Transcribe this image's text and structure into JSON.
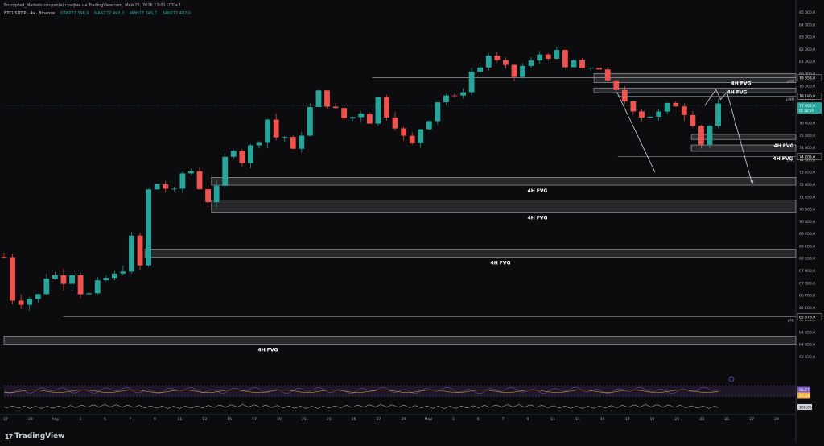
{
  "header": {
    "author_line": "Encrypted_Markets создал(а) график на TradingView.com, Май 25, 2026 12:01 UTC+3",
    "symbol": "BTCUSDT.P · 4ч · Binance",
    "open": "ОТКР77 396,9",
    "high": "МАКС77 493,0",
    "low": "МИН77 345,7",
    "close": "ЗАКР77 402,0"
  },
  "brand": {
    "mark": "17",
    "name": "TradingView"
  },
  "chart_data": {
    "type": "candlestick",
    "price_axis": {
      "ticks": [
        "85 000,0",
        "84 000,0",
        "83 000,0",
        "82 000,0",
        "81 000,0",
        "80 000,0",
        "79 000,0",
        "78 000,0",
        "77 000,0",
        "76 400,0",
        "75 600,0",
        "74 800,0",
        "74 000,0",
        "73 200,0",
        "72 400,0",
        "71 650,0",
        "70 900,0",
        "70 300,0",
        "69 700,0",
        "69 100,0",
        "68 550,0",
        "67 900,0",
        "67 300,0",
        "66 700,0",
        "66 100,0",
        "65 550,0",
        "64 950,0",
        "64 350,0",
        "63 830,0"
      ],
      "ylim": [
        63200,
        85300
      ]
    },
    "price_labels": [
      {
        "value": "79 653,0",
        "price": 79653,
        "tag": "pWH"
      },
      {
        "value": "78 180,0",
        "price": 78180,
        "tag": "pWM"
      },
      {
        "value": "74 205,6",
        "price": 74205.6,
        "tag": "pWL"
      },
      {
        "value": "65 676,9",
        "price": 65676.9,
        "tag": "pML"
      }
    ],
    "current_price": {
      "value": "77 402,0",
      "countdown": "01:58:59",
      "price": 77402
    },
    "oscillator_labels": [
      {
        "value": "56,27",
        "color": "#7e57c2"
      },
      {
        "value": "47,54",
        "color": "#f2b134"
      }
    ],
    "lower_label": "100,05 k",
    "x_ticks": [
      "27",
      "29",
      "Апр",
      "3",
      "5",
      "7",
      "9",
      "11",
      "13",
      "15",
      "17",
      "19",
      "21",
      "23",
      "25",
      "27",
      "29",
      "Май",
      "3",
      "5",
      "7",
      "9",
      "11",
      "13",
      "15",
      "17",
      "19",
      "21",
      "23",
      "25",
      "27",
      "29"
    ],
    "fvg_zones": [
      {
        "label": "4H FVG",
        "low": 79280,
        "high": 80000,
        "start": 0.745
      },
      {
        "label": "4H FVG",
        "low": 78450,
        "high": 78830,
        "start": 0.745
      },
      {
        "label": "4H FVG",
        "low": 75320,
        "high": 75650,
        "start": 0.868
      },
      {
        "label": "4H FVG",
        "low": 74550,
        "high": 74960,
        "start": 0.868
      },
      {
        "label": "4H FVG",
        "low": 72350,
        "high": 72850,
        "start": 0.262
      },
      {
        "label": "4H FVG",
        "low": 70750,
        "high": 71450,
        "start": 0.262
      },
      {
        "label": "4H FVG",
        "low": 68600,
        "high": 68950,
        "start": 0.178
      },
      {
        "label": "4H FVG",
        "low": 64350,
        "high": 64750,
        "start": 0.0
      }
    ],
    "levels": [
      {
        "tag": "pWH",
        "price": 79653,
        "start": 0.465
      },
      {
        "tag": "pWM",
        "price": 78180,
        "start": 0.775
      },
      {
        "tag": "pWL",
        "price": 74205.6,
        "start": 0.775
      },
      {
        "tag": "pML",
        "price": 65676.9,
        "start": 0.075
      }
    ],
    "projection": [
      [
        0.885,
        77400
      ],
      [
        0.899,
        78700
      ],
      [
        0.905,
        77900
      ],
      [
        0.913,
        78500
      ],
      [
        0.945,
        72400
      ]
    ],
    "drop_arrow": [
      [
        0.774,
        78500
      ],
      [
        0.822,
        73200
      ]
    ],
    "anchors": [
      [
        0,
        68600
      ],
      [
        0.012,
        66300
      ],
      [
        0.028,
        66500
      ],
      [
        0.045,
        66700
      ],
      [
        0.06,
        68300
      ],
      [
        0.072,
        66500
      ],
      [
        0.08,
        68900
      ],
      [
        0.09,
        67100
      ],
      [
        0.105,
        66600
      ],
      [
        0.118,
        67200
      ],
      [
        0.135,
        67700
      ],
      [
        0.148,
        67500
      ],
      [
        0.158,
        69800
      ],
      [
        0.172,
        68100
      ],
      [
        0.182,
        72000
      ],
      [
        0.198,
        72600
      ],
      [
        0.212,
        71600
      ],
      [
        0.222,
        72800
      ],
      [
        0.232,
        73700
      ],
      [
        0.245,
        72400
      ],
      [
        0.255,
        71500
      ],
      [
        0.265,
        71200
      ],
      [
        0.275,
        73800
      ],
      [
        0.29,
        74800
      ],
      [
        0.302,
        73800
      ],
      [
        0.312,
        74900
      ],
      [
        0.322,
        75300
      ],
      [
        0.332,
        76700
      ],
      [
        0.342,
        75400
      ],
      [
        0.352,
        75900
      ],
      [
        0.362,
        74200
      ],
      [
        0.372,
        75300
      ],
      [
        0.382,
        76400
      ],
      [
        0.395,
        78700
      ],
      [
        0.408,
        77500
      ],
      [
        0.42,
        77000
      ],
      [
        0.435,
        76400
      ],
      [
        0.448,
        77100
      ],
      [
        0.462,
        76500
      ],
      [
        0.472,
        78100
      ],
      [
        0.482,
        76900
      ],
      [
        0.495,
        76200
      ],
      [
        0.508,
        75200
      ],
      [
        0.518,
        74900
      ],
      [
        0.528,
        76300
      ],
      [
        0.54,
        76800
      ],
      [
        0.552,
        78300
      ],
      [
        0.565,
        78200
      ],
      [
        0.575,
        77800
      ],
      [
        0.588,
        80100
      ],
      [
        0.6,
        80400
      ],
      [
        0.612,
        81500
      ],
      [
        0.622,
        81000
      ],
      [
        0.632,
        80600
      ],
      [
        0.645,
        79700
      ],
      [
        0.655,
        80600
      ],
      [
        0.665,
        80900
      ],
      [
        0.675,
        81600
      ],
      [
        0.688,
        81400
      ],
      [
        0.698,
        81700
      ],
      [
        0.708,
        80400
      ],
      [
        0.72,
        81100
      ],
      [
        0.728,
        80600
      ],
      [
        0.736,
        79200
      ],
      [
        0.745,
        81600
      ],
      [
        0.752,
        80400
      ],
      [
        0.762,
        79300
      ],
      [
        0.772,
        78600
      ],
      [
        0.782,
        77900
      ],
      [
        0.792,
        77300
      ],
      [
        0.802,
        76700
      ],
      [
        0.812,
        76900
      ],
      [
        0.822,
        76600
      ],
      [
        0.832,
        77100
      ],
      [
        0.842,
        77700
      ],
      [
        0.852,
        77300
      ],
      [
        0.862,
        76800
      ],
      [
        0.87,
        76400
      ],
      [
        0.877,
        74700
      ],
      [
        0.885,
        75500
      ],
      [
        0.893,
        76400
      ],
      [
        0.902,
        77400
      ]
    ],
    "grid": false
  }
}
